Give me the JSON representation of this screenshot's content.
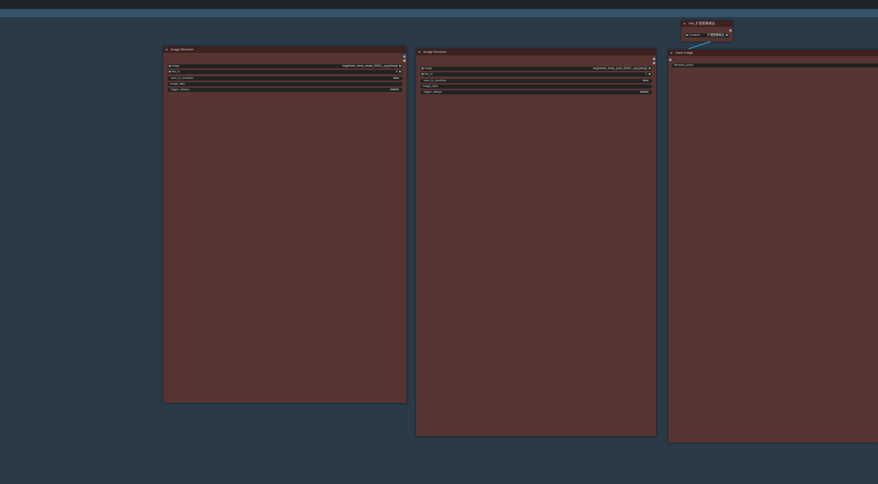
{
  "nodes": {
    "receiver1": {
      "title": "Image Receiver",
      "widgets": {
        "image": {
          "label": "image",
          "value": "img2ender_temp_sbaat_00001_.png [temp]"
        },
        "link_id": {
          "label": "link_id",
          "value": "6"
        },
        "save_to_workflow": {
          "label": "save_to_workflow",
          "value": "false"
        },
        "image_data": {
          "label": "image_data"
        },
        "trigger_always": {
          "label": "trigger_always",
          "value": "disable"
        }
      }
    },
    "receiver2": {
      "title": "Image Receiver",
      "widgets": {
        "image": {
          "label": "image",
          "value": "img2ender_temp_ynvil_00001_.png [temp]"
        },
        "link_id": {
          "label": "link_id",
          "value": "1"
        },
        "save_to_workflow": {
          "label": "save_to_workflow",
          "value": "false"
        },
        "image_data": {
          "label": "image_data"
        },
        "trigger_always": {
          "label": "trigger_always",
          "value": "disable"
        }
      }
    },
    "get_node": {
      "title": "Get_扩图图像输出",
      "widgets": {
        "constant": {
          "label": "Constant",
          "value": "扩图图像输出"
        }
      }
    },
    "save_image": {
      "title": "Save Image",
      "widgets": {
        "filename_prefix": {
          "label": "filename_prefix"
        }
      }
    }
  },
  "colors": {
    "canvas": "#2a3a46",
    "node_body": "#563432",
    "node_title": "#3c2120",
    "link": "#3aa3d8"
  }
}
